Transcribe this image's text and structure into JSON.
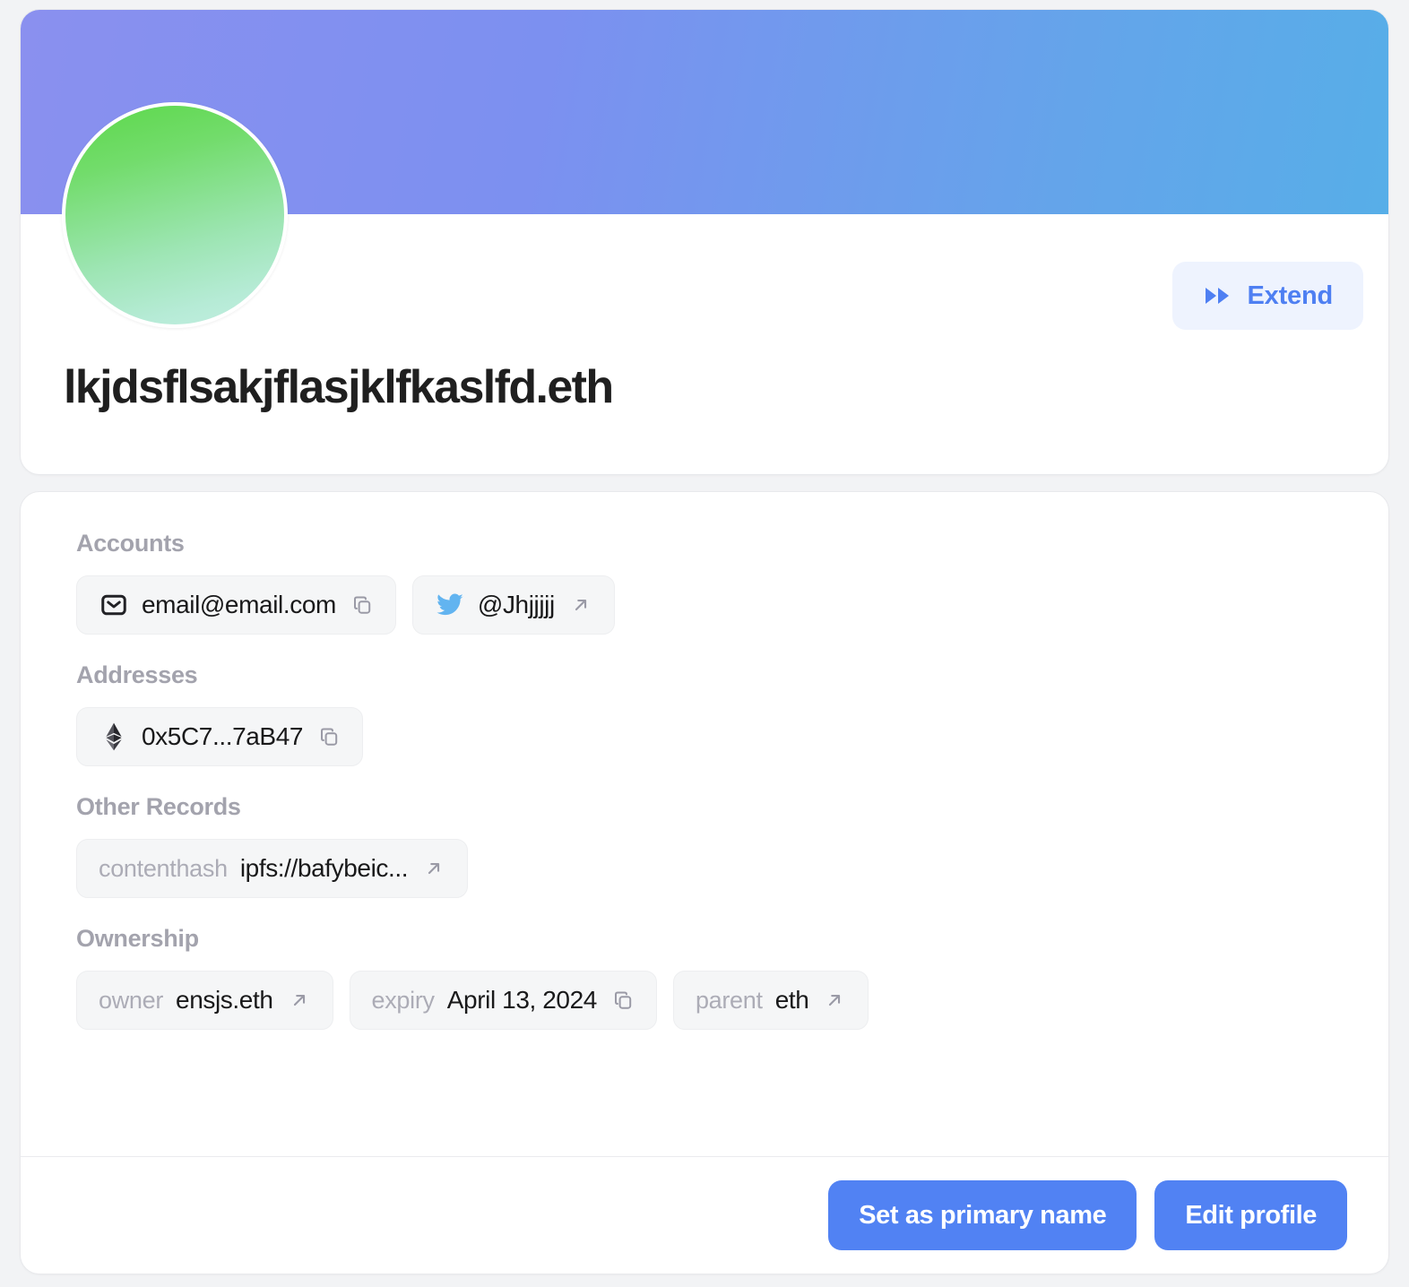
{
  "header": {
    "profile_name": "lkjdsflsakjflasjklfkaslfd.eth",
    "extend_button": "Extend",
    "banner_gradient_from": "#8A90EF",
    "banner_gradient_to": "#57AEE8",
    "avatar_gradient_from": "#5CD84A",
    "avatar_gradient_to": "#C3EEE2",
    "accent_color": "#4E7FF2"
  },
  "sections": {
    "accounts": {
      "title": "Accounts",
      "items": [
        {
          "icon": "email-icon",
          "value": "email@email.com",
          "action": "copy-icon"
        },
        {
          "icon": "twitter-icon",
          "value": "@Jhjjjjj",
          "action": "external-link-icon"
        }
      ]
    },
    "addresses": {
      "title": "Addresses",
      "items": [
        {
          "icon": "ethereum-icon",
          "value": "0x5C7...7aB47",
          "action": "copy-icon"
        }
      ]
    },
    "other_records": {
      "title": "Other Records",
      "items": [
        {
          "key": "contenthash",
          "value": "ipfs://bafybeic...",
          "action": "external-link-icon"
        }
      ]
    },
    "ownership": {
      "title": "Ownership",
      "items": [
        {
          "key": "owner",
          "value": "ensjs.eth",
          "action": "external-link-icon"
        },
        {
          "key": "expiry",
          "value": "April 13, 2024",
          "action": "copy-icon"
        },
        {
          "key": "parent",
          "value": "eth",
          "action": "external-link-icon"
        }
      ]
    }
  },
  "footer": {
    "set_primary_label": "Set as primary name",
    "edit_profile_label": "Edit profile",
    "button_color": "#5182F3"
  }
}
